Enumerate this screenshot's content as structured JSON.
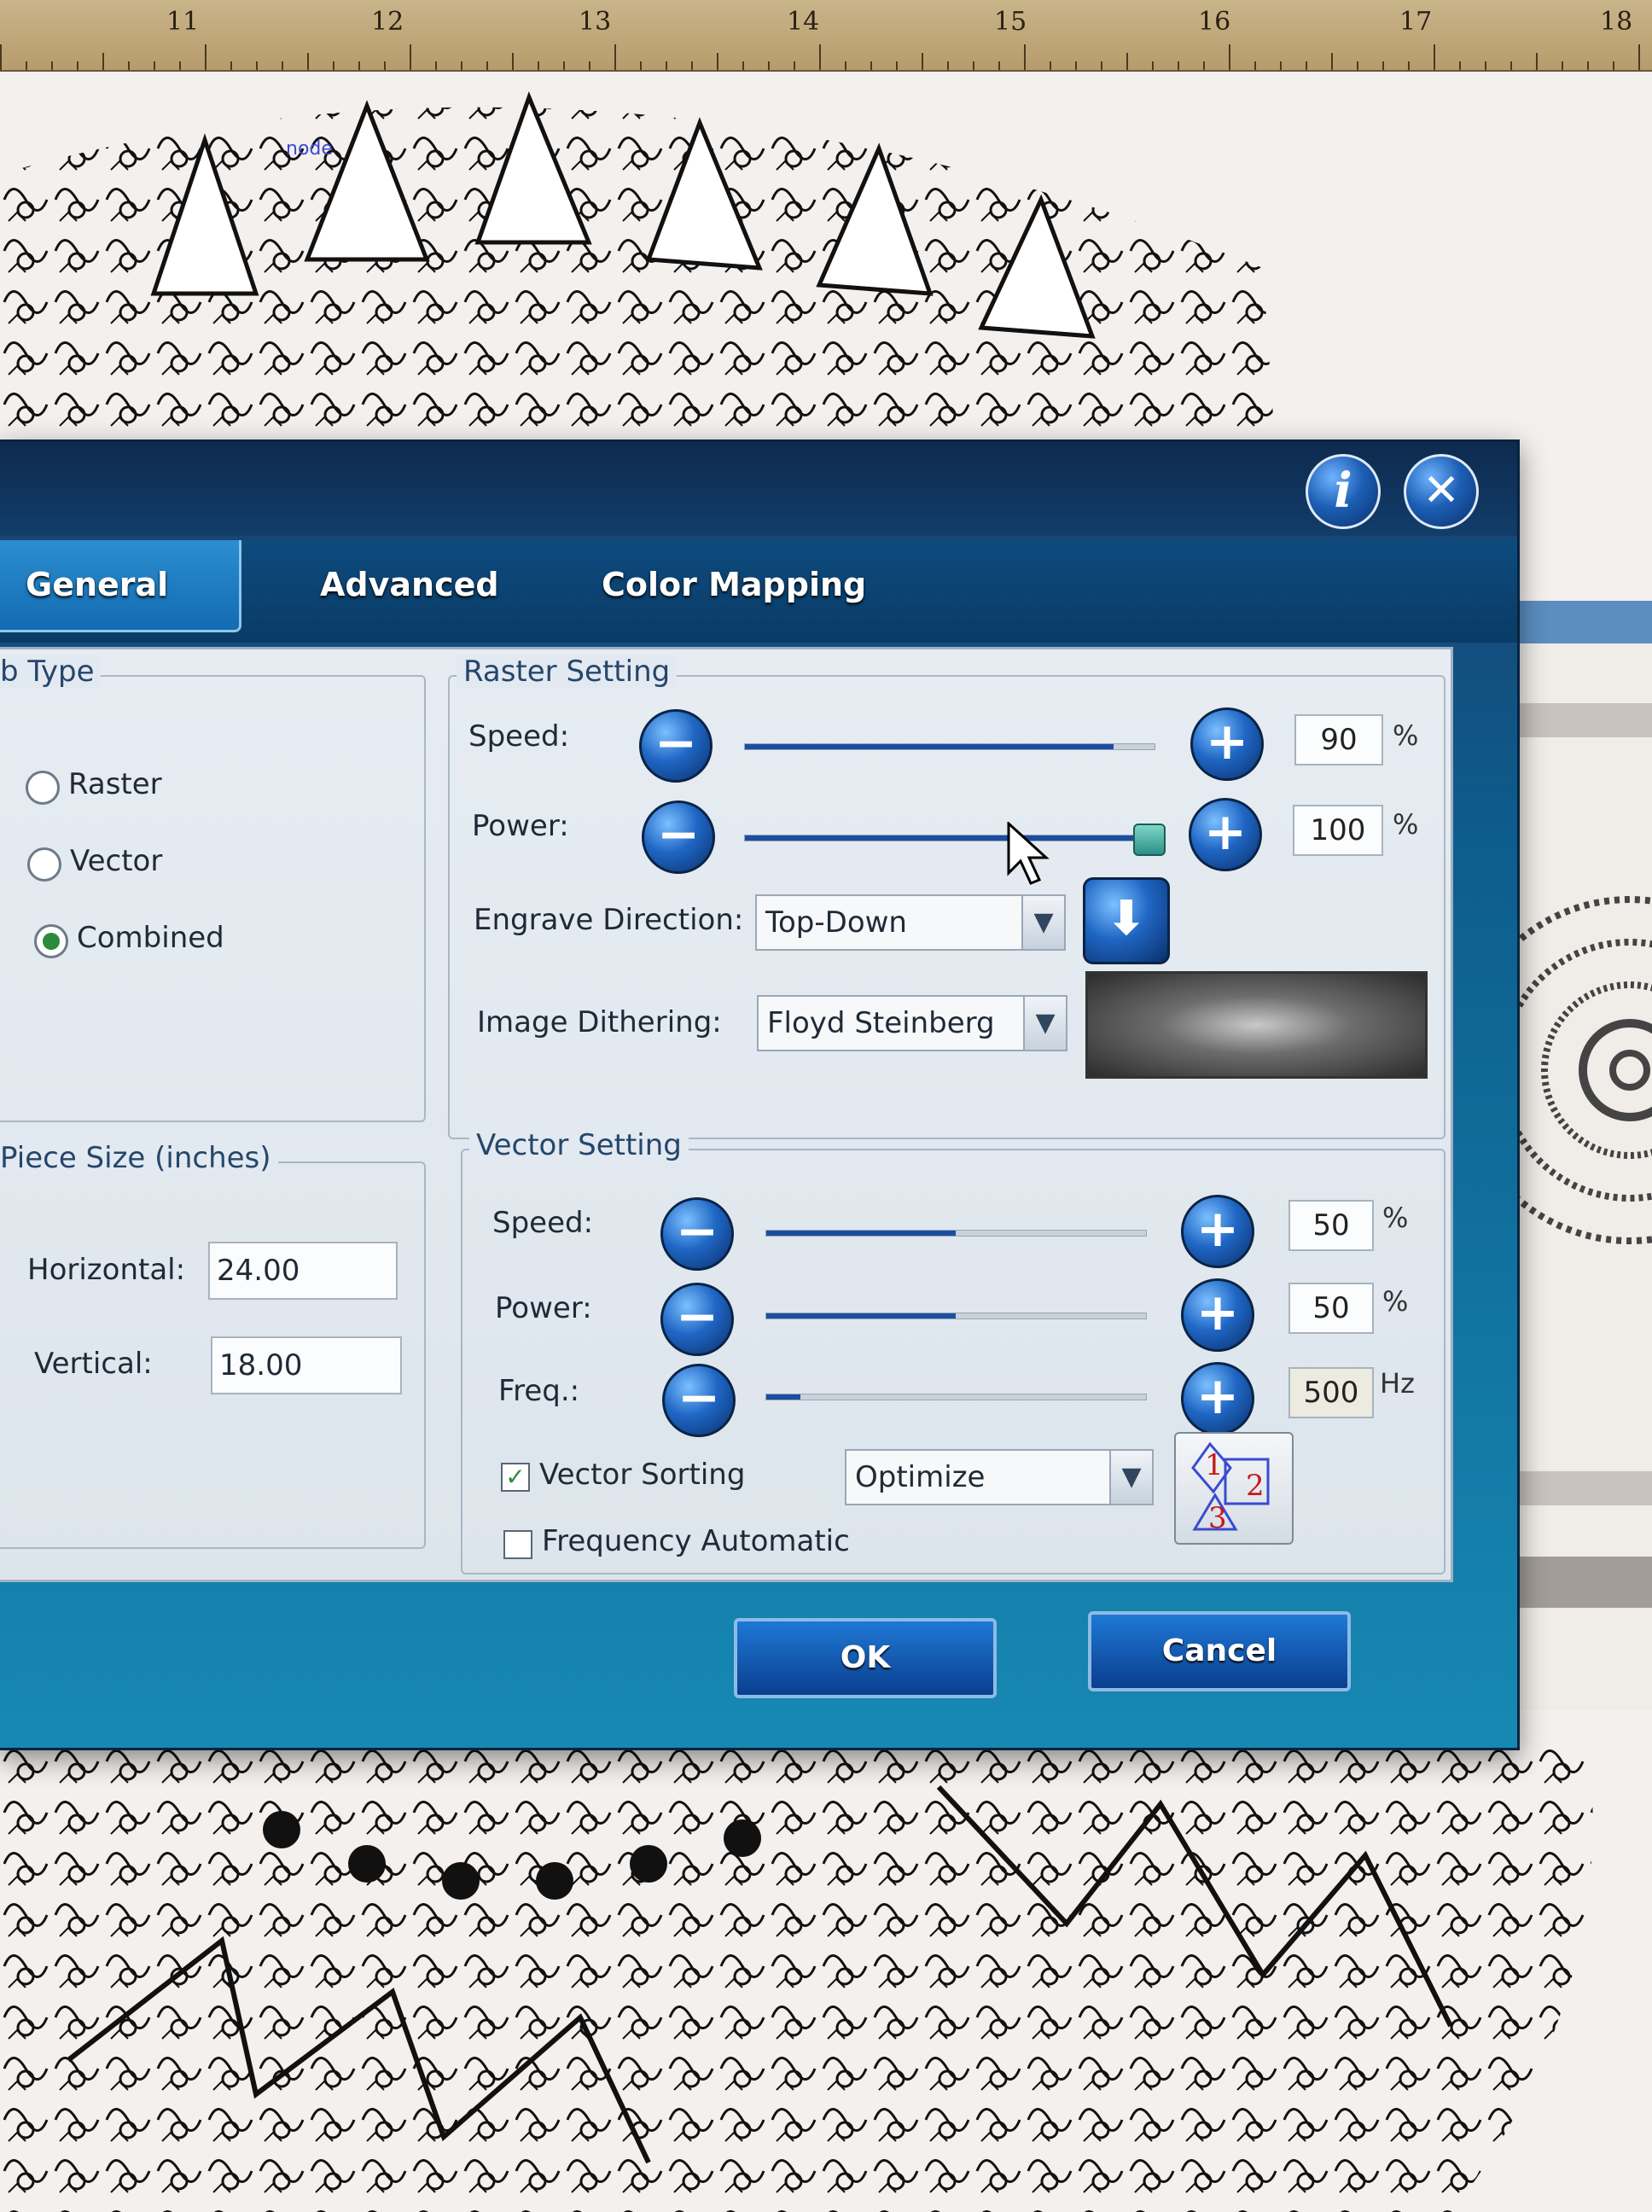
{
  "ruler": {
    "numbers": [
      "11",
      "12",
      "13",
      "14",
      "15",
      "16",
      "17",
      "18"
    ]
  },
  "canvas": {
    "node_label": "node"
  },
  "dialog": {
    "tabs": [
      {
        "label": "General",
        "active": true
      },
      {
        "label": "Advanced",
        "active": false
      },
      {
        "label": "Color Mapping",
        "active": false
      }
    ],
    "job_type": {
      "title": "b Type",
      "options": [
        {
          "label": "Raster",
          "selected": false
        },
        {
          "label": "Vector",
          "selected": false
        },
        {
          "label": "Combined",
          "selected": true
        }
      ]
    },
    "piece_size": {
      "title": "Piece Size (inches)",
      "horizontal_label": "Horizontal:",
      "horizontal_value": "24.00",
      "vertical_label": "Vertical:",
      "vertical_value": "18.00"
    },
    "raster": {
      "title": "Raster Setting",
      "speed_label": "Speed:",
      "speed_value": "90",
      "speed_unit": "%",
      "power_label": "Power:",
      "power_value": "100",
      "power_unit": "%",
      "engrave_label": "Engrave Direction:",
      "engrave_value": "Top-Down",
      "dither_label": "Image Dithering:",
      "dither_value": "Floyd Steinberg"
    },
    "vector": {
      "title": "Vector Setting",
      "speed_label": "Speed:",
      "speed_value": "50",
      "speed_unit": "%",
      "power_label": "Power:",
      "power_value": "50",
      "power_unit": "%",
      "freq_label": "Freq.:",
      "freq_value": "500",
      "freq_unit": "Hz",
      "sorting_label": "Vector Sorting",
      "sorting_checked": true,
      "sorting_value": "Optimize",
      "freq_auto_label": "Frequency Automatic",
      "freq_auto_checked": false
    },
    "buttons": {
      "ok": "OK",
      "cancel": "Cancel"
    }
  },
  "colors": {
    "dialog_blue": "#0d5c8c",
    "accent": "#1f66c4",
    "slider_fill": "#1c4da2"
  }
}
